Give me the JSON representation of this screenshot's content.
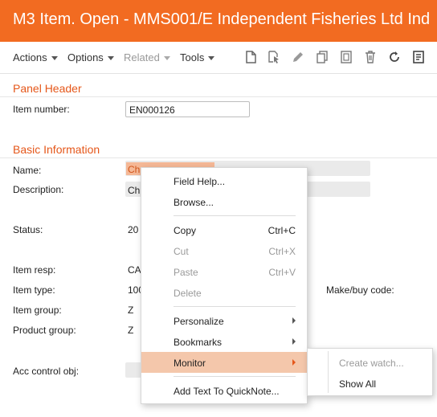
{
  "window": {
    "title": "M3 Item. Open - MMS001/E   Independent Fisheries Ltd Ind"
  },
  "toolbar": {
    "menus": [
      {
        "label": "Actions",
        "enabled": true
      },
      {
        "label": "Options",
        "enabled": true
      },
      {
        "label": "Related",
        "enabled": false
      },
      {
        "label": "Tools",
        "enabled": true
      }
    ],
    "icons": [
      "new-icon",
      "copy-pointer-icon",
      "edit-icon",
      "duplicate-icon",
      "duplicate-page-icon",
      "delete-icon",
      "refresh-icon",
      "notes-icon"
    ]
  },
  "panel_header": {
    "title": "Panel Header",
    "item_number_label": "Item number:",
    "item_number_value": "EN000126"
  },
  "basic_info": {
    "title": "Basic Information",
    "name_label": "Name:",
    "name_value": "Ch",
    "description_label": "Description:",
    "description_value": "Ch",
    "status_label": "Status:",
    "status_value": "20",
    "item_resp_label": "Item resp:",
    "item_resp_value": "CA",
    "item_type_label": "Item type:",
    "item_type_value": "100",
    "make_buy_label": "Make/buy code:",
    "item_group_label": "Item group:",
    "item_group_value": "Z",
    "product_group_label": "Product group:",
    "product_group_value": "Z",
    "acc_control_label": "Acc control obj:"
  },
  "context_menu": {
    "field_help": "Field Help...",
    "browse": "Browse...",
    "copy": "Copy",
    "copy_shortcut": "Ctrl+C",
    "cut": "Cut",
    "cut_shortcut": "Ctrl+X",
    "paste": "Paste",
    "paste_shortcut": "Ctrl+V",
    "delete": "Delete",
    "personalize": "Personalize",
    "bookmarks": "Bookmarks",
    "monitor": "Monitor",
    "add_quicknote": "Add Text To QuickNote..."
  },
  "submenu": {
    "create_watch": "Create watch...",
    "show_all": "Show All"
  },
  "colors": {
    "brand": "#f26b21",
    "accent": "#e5571a",
    "highlight": "#f4c7ab"
  }
}
